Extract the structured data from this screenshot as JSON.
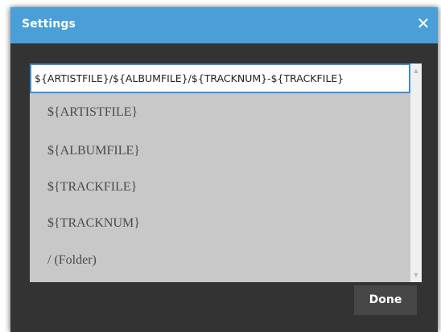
{
  "dialog": {
    "title": "Settings",
    "close_icon": "close-icon",
    "close_glyph": "✕"
  },
  "pattern_input": {
    "value": "${ARTISTFILE}/${ALBUMFILE}/${TRACKNUM}-${TRACKFILE}"
  },
  "options": [
    {
      "label": "${ARTISTFILE}"
    },
    {
      "label": "${ALBUMFILE}"
    },
    {
      "label": "${TRACKFILE}"
    },
    {
      "label": "${TRACKNUM}"
    },
    {
      "label": "/  (Folder)"
    }
  ],
  "scrollbar": {
    "up_glyph": "▲",
    "down_glyph": "▼"
  },
  "footer": {
    "done_label": "Done"
  },
  "colors": {
    "titlebar": "#4a9fd8",
    "dialog_bg": "#333333",
    "list_bg": "#c8c8c8",
    "input_border": "#3b8fd6",
    "button_bg": "#474747"
  }
}
